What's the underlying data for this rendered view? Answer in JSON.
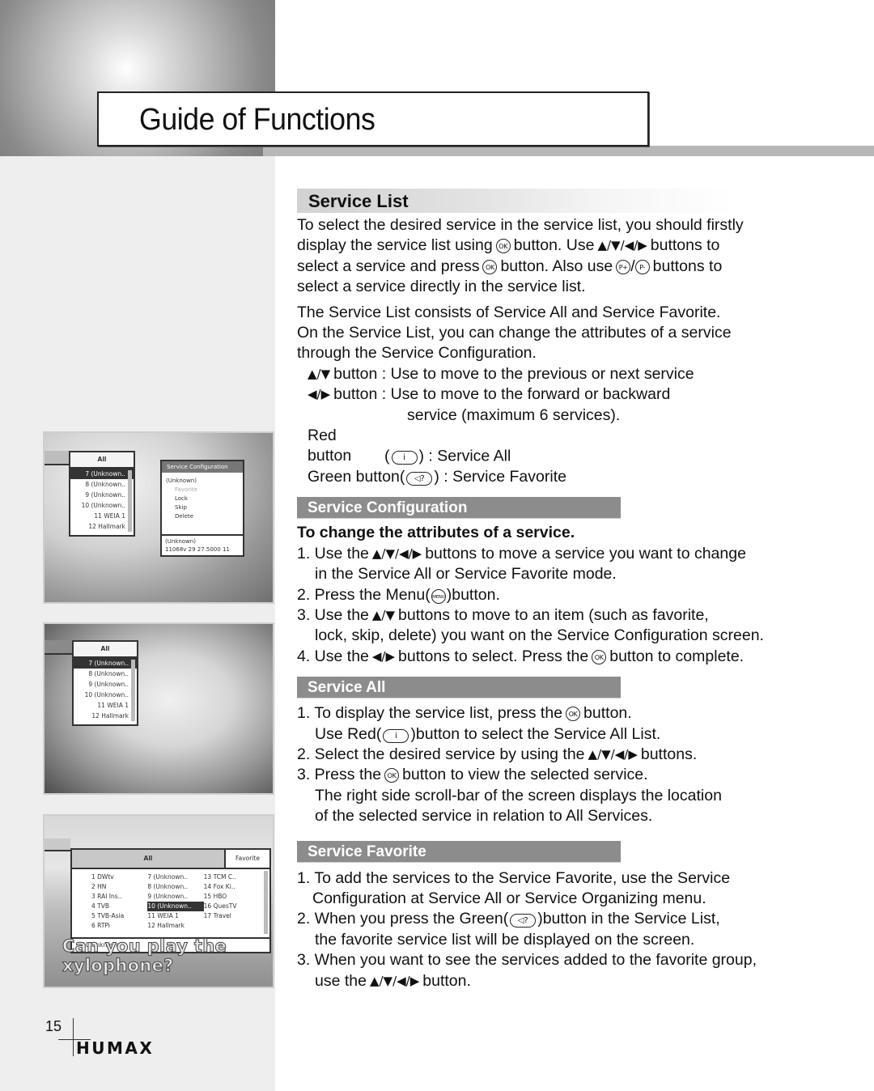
{
  "header": {
    "title": "Guide of Functions"
  },
  "icons": {
    "ok": "OK",
    "menu": "MENU",
    "p_plus": "P+",
    "p_minus": "P-",
    "red_info": "i",
    "green_audio": "◁?",
    "arrows_4": "▲/▼/◀/▶",
    "arrows_updown": "▲/▼",
    "arrows_leftright": "◀/▶"
  },
  "service_list": {
    "heading": "Service List",
    "intro": {
      "p1_a": "To select the desired service in the service list, you should firstly",
      "p1_b1": "display the service list using",
      "p1_b2": "button. Use",
      "p1_b3": "buttons to",
      "p1_c1": "select a service and press",
      "p1_c2": "button. Also use",
      "p1_c3": "/",
      "p1_c4": "buttons to",
      "p1_d": "select a service directly in the service list."
    },
    "p2": [
      "The Service List consists of Service All and Service Favorite.",
      "On the Service List, you can change the attributes of a service",
      "through the Service Configuration."
    ],
    "buttons": {
      "updown_label": "button : Use to move to the previous or next service",
      "leftright_label": "button : Use to move to the forward or backward",
      "leftright_cont": "service (maximum 6 services).",
      "red_label": "Red button",
      "red_desc": ") : Service All",
      "green_label": "Green button(",
      "green_desc": ") : Service Favorite",
      "open_paren": "("
    }
  },
  "service_configuration": {
    "heading": "Service Configuration",
    "subheading": "To change the attributes of a service.",
    "steps": {
      "s1_a": "1. Use the",
      "s1_b": "buttons to move a service you want to change",
      "s1_c": "in the Service All or Service Favorite mode.",
      "s2_a": "2. Press the Menu(",
      "s2_b": ")button.",
      "s3_a": "3. Use the",
      "s3_b": "buttons to move to an item (such as favorite,",
      "s3_c": "lock, skip, delete) you want on the Service Configuration screen.",
      "s4_a": "4. Use the",
      "s4_b": "buttons to select. Press the",
      "s4_c": "button to complete."
    }
  },
  "service_all": {
    "heading": "Service All",
    "steps": {
      "s1_a": "1. To display the service list, press the",
      "s1_b": "button.",
      "s1_c": "Use Red(",
      "s1_d": ")button to select the Service All List.",
      "s2_a": "2. Select the desired service by using the",
      "s2_b": "buttons.",
      "s3_a": "3. Press the",
      "s3_b": "button to view the selected service.",
      "s3_c": "The right side scroll-bar of the screen displays the location",
      "s3_d": "of the selected service in relation to All Services."
    }
  },
  "service_favorite": {
    "heading": "Service Favorite",
    "steps": {
      "s1_a": "1. To add the services to the Service Favorite, use the Service",
      "s1_b": "Configuration at Service All or Service Organizing menu.",
      "s2_a": "2. When you press the Green(",
      "s2_b": ")button in the Service List,",
      "s2_c": "the favorite service list will be displayed on the screen.",
      "s3_a": "3. When you want to see the services added to the favorite group,",
      "s3_b": "use the",
      "s3_c": "button."
    }
  },
  "screenshots": {
    "shot1": {
      "list_header": "All",
      "rows": [
        "7 (Unknown..",
        "8 (Unknown..",
        "9 (Unknown..",
        "10 (Unknown..",
        "11 WEIA 1",
        "12 Hallmark"
      ],
      "selected_index": 0,
      "dialog_title": "Service Configuration",
      "dialog_name": "(Unknown)",
      "dialog_items": [
        "Favorite",
        "Lock",
        "Skip",
        "Delete"
      ],
      "dialog_footer_1": "(Unknown)",
      "dialog_footer_2": "11068v 29  27.5000  11"
    },
    "shot2": {
      "list_header": "All",
      "rows": [
        "7 (Unknown..",
        "8 (Unknown..",
        "9 (Unknown..",
        "10 (Unknown..",
        "11 WEIA 1",
        "12 Hallmark"
      ],
      "selected_index": 0
    },
    "shot3": {
      "tab_all": "All",
      "tab_favorite": "Favorite",
      "cells": [
        "1 DWtv",
        "7 (Unknown..",
        "13 TCM C..",
        "2 HN",
        "8 (Unknown..",
        "14 Fox Ki..",
        "3 RAI Ins..",
        "9 (Unknown..",
        "15 HBO",
        "4 TVB",
        "10 (Unknown..",
        "16 QuesTV",
        "5 TVB-Asia",
        "11 WEIA 1",
        "17 Travel",
        "6 RTPi",
        "12 Hallmark",
        ""
      ],
      "selected_cell": 10,
      "footer": "10  Unknown",
      "caption": "Can you play the xylophone?"
    }
  },
  "footer": {
    "page_number": "15",
    "brand": "HUMAX"
  }
}
